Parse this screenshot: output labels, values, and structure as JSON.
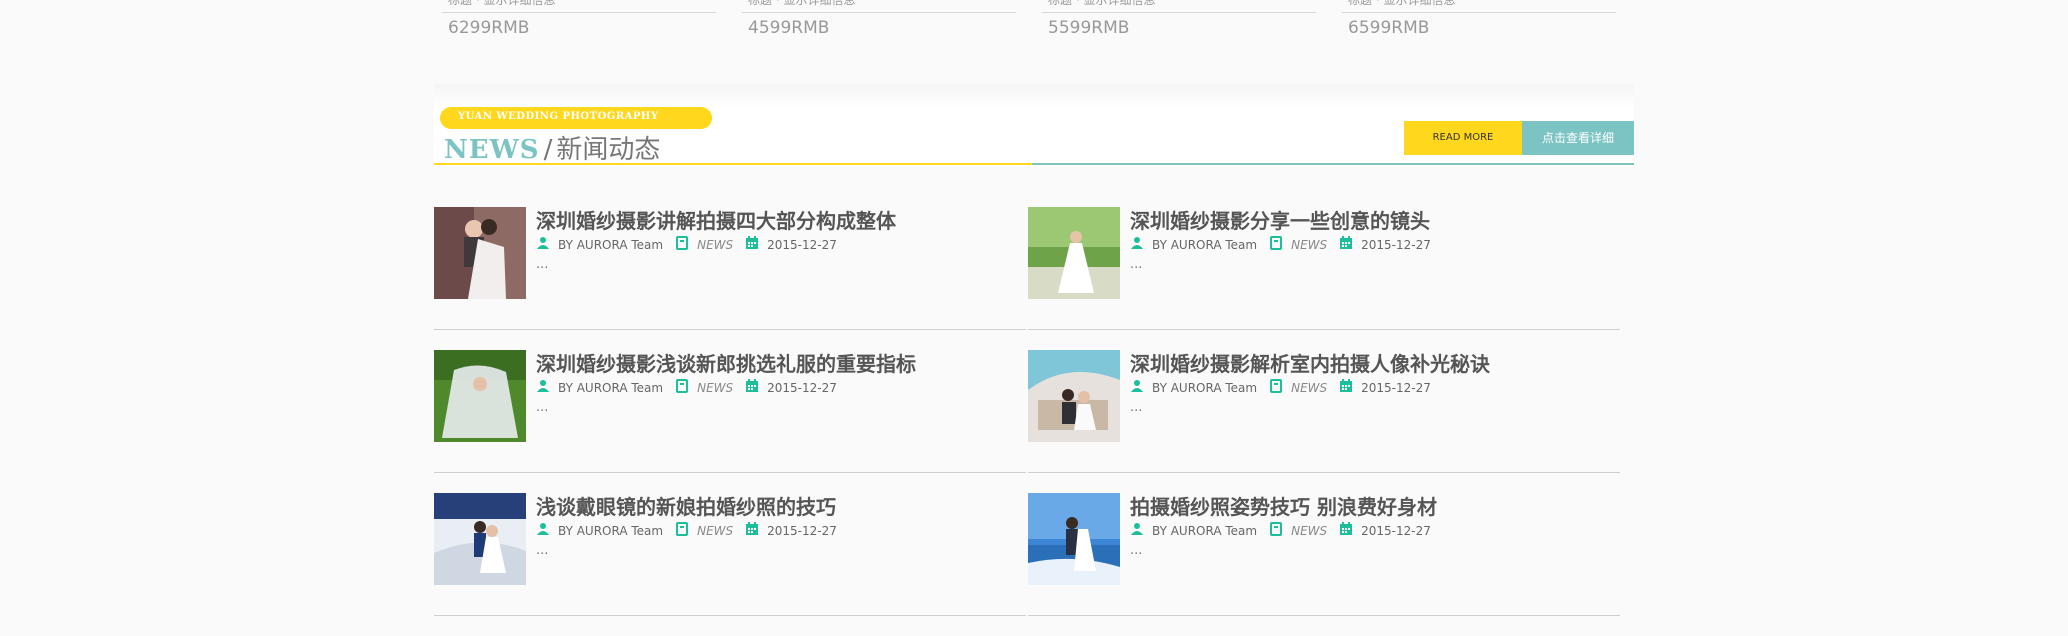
{
  "products": [
    {
      "caption": "标题 · 显示详细信息",
      "price": "6299RMB"
    },
    {
      "caption": "标题 · 显示详细信息",
      "price": "4599RMB"
    },
    {
      "caption": "标题 · 显示详细信息",
      "price": "5599RMB"
    },
    {
      "caption": "标题 · 显示详细信息",
      "price": "6599RMB"
    }
  ],
  "news": {
    "tag": "YUAN WEDDING PHOTOGRAPHY",
    "title_en": "NEWS",
    "title_sep": "/",
    "title_cn": "新闻动态",
    "read_more": "READ MORE",
    "view_detail": "点击查看详细"
  },
  "items": [
    {
      "title": "深圳婚纱摄影讲解拍摄四大部分构成整体",
      "author": "BY AURORA Team",
      "category": "NEWS",
      "date": "2015-12-27",
      "excerpt": "..."
    },
    {
      "title": "深圳婚纱摄影分享一些创意的镜头",
      "author": "BY AURORA Team",
      "category": "NEWS",
      "date": "2015-12-27",
      "excerpt": "..."
    },
    {
      "title": "深圳婚纱摄影浅谈新郎挑选礼服的重要指标",
      "author": "BY AURORA Team",
      "category": "NEWS",
      "date": "2015-12-27",
      "excerpt": "..."
    },
    {
      "title": "深圳婚纱摄影解析室内拍摄人像补光秘诀",
      "author": "BY AURORA Team",
      "category": "NEWS",
      "date": "2015-12-27",
      "excerpt": "..."
    },
    {
      "title": "浅谈戴眼镜的新娘拍婚纱照的技巧",
      "author": "BY AURORA Team",
      "category": "NEWS",
      "date": "2015-12-27",
      "excerpt": "..."
    },
    {
      "title": "拍摄婚纱照姿势技巧 别浪费好身材",
      "author": "BY AURORA Team",
      "category": "NEWS",
      "date": "2015-12-27",
      "excerpt": "..."
    }
  ],
  "colors": {
    "accent_yellow": "#ffd81e",
    "accent_teal": "#7cc4c4",
    "icon_teal": "#1cbf9a"
  },
  "icons": {
    "author": "user-icon",
    "category": "book-icon",
    "date": "calendar-icon"
  }
}
